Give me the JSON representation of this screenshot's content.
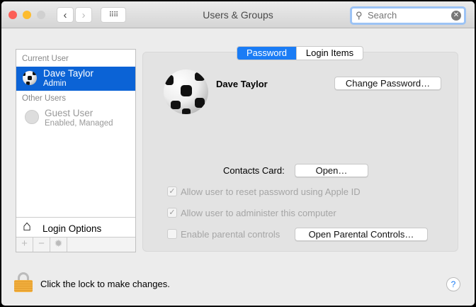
{
  "window": {
    "title": "Users & Groups"
  },
  "search": {
    "placeholder": "Search"
  },
  "sidebar": {
    "current_user_header": "Current User",
    "current_user": {
      "name": "Dave Taylor",
      "role": "Admin"
    },
    "other_users_header": "Other Users",
    "other_users": [
      {
        "name": "Guest User",
        "status": "Enabled, Managed"
      }
    ],
    "login_options": "Login Options",
    "add": "+",
    "remove": "−"
  },
  "tabs": [
    {
      "label": "Password",
      "active": true
    },
    {
      "label": "Login Items",
      "active": false
    }
  ],
  "detail": {
    "user_name": "Dave Taylor",
    "change_password": "Change Password…",
    "contacts_label": "Contacts Card:",
    "open": "Open…",
    "options": [
      {
        "label": "Allow user to reset password using Apple ID",
        "checked": true
      },
      {
        "label": "Allow user to administer this computer",
        "checked": true
      },
      {
        "label": "Enable parental controls",
        "checked": false
      }
    ],
    "open_parental": "Open Parental Controls…"
  },
  "footer": {
    "lock_text": "Click the lock to make changes.",
    "help": "?"
  },
  "colors": {
    "accent": "#0b63d6"
  }
}
